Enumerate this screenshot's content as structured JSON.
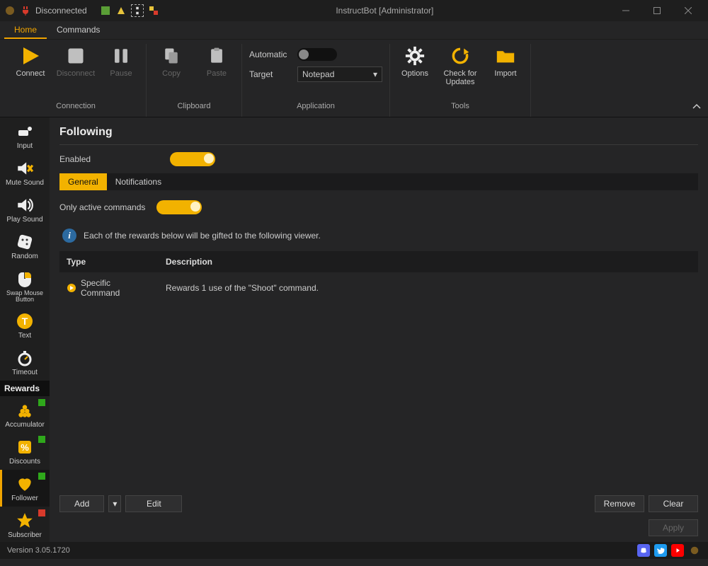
{
  "window": {
    "title": "InstructBot [Administrator]",
    "connection_status": "Disconnected"
  },
  "menubar": [
    "Home",
    "Commands"
  ],
  "ribbon": {
    "groups": {
      "connection": {
        "label": "Connection",
        "buttons": {
          "connect": "Connect",
          "disconnect": "Disconnect",
          "pause": "Pause"
        }
      },
      "clipboard": {
        "label": "Clipboard",
        "buttons": {
          "copy": "Copy",
          "paste": "Paste"
        }
      },
      "application": {
        "label": "Application",
        "automatic_label": "Automatic",
        "automatic_on": false,
        "target_label": "Target",
        "target_value": "Notepad"
      },
      "tools": {
        "label": "Tools",
        "buttons": {
          "options": "Options",
          "check": "Check for\nUpdates",
          "import": "Import"
        }
      }
    }
  },
  "side": {
    "upper": [
      {
        "id": "input",
        "label": "Input",
        "icon": "input-icon"
      },
      {
        "id": "mute-sound",
        "label": "Mute Sound",
        "icon": "mute-icon"
      },
      {
        "id": "play-sound",
        "label": "Play Sound",
        "icon": "speaker-icon"
      },
      {
        "id": "random",
        "label": "Random",
        "icon": "dice-icon"
      },
      {
        "id": "swap-mouse",
        "label": "Swap Mouse Button",
        "icon": "mouse-icon"
      },
      {
        "id": "text",
        "label": "Text",
        "icon": "text-icon"
      },
      {
        "id": "timeout",
        "label": "Timeout",
        "icon": "stopwatch-icon"
      }
    ],
    "rewards_header": "Rewards",
    "rewards": [
      {
        "id": "accumulator",
        "label": "Accumulator",
        "dot": "green",
        "icon": "accumulator-icon"
      },
      {
        "id": "discounts",
        "label": "Discounts",
        "dot": "green",
        "icon": "discount-icon"
      },
      {
        "id": "follower",
        "label": "Follower",
        "dot": "green",
        "icon": "heart-icon",
        "active": true
      },
      {
        "id": "subscriber",
        "label": "Subscriber",
        "dot": "red",
        "icon": "star-icon"
      }
    ]
  },
  "page": {
    "title": "Following",
    "enabled_label": "Enabled",
    "enabled_on": true,
    "tabs": [
      "General",
      "Notifications"
    ],
    "active_tab": "General",
    "only_active_label": "Only active commands",
    "only_active_on": true,
    "info_text": "Each of the rewards below will be gifted to the following viewer.",
    "columns": {
      "type": "Type",
      "description": "Description"
    },
    "rows": [
      {
        "type": "Specific Command",
        "description": "Rewards 1 use of the \"Shoot\" command."
      }
    ],
    "buttons": {
      "add": "Add",
      "edit": "Edit",
      "remove": "Remove",
      "clear": "Clear",
      "apply": "Apply"
    }
  },
  "status": {
    "version": "Version 3.05.1720"
  },
  "colors": {
    "accent": "#f2b200"
  }
}
